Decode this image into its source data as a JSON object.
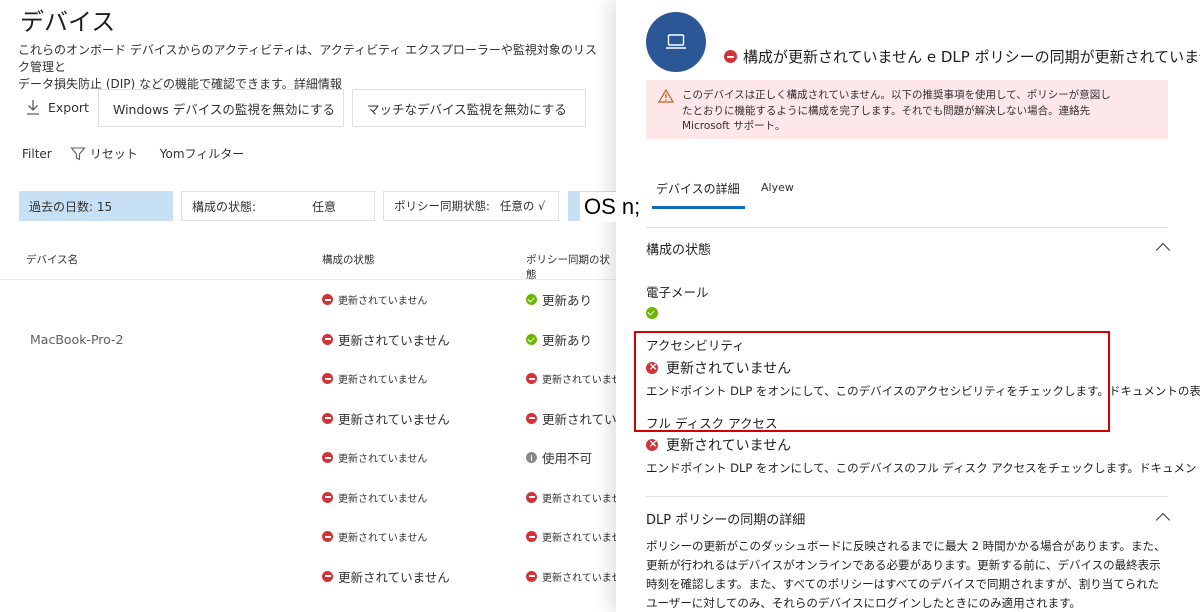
{
  "left": {
    "title": "デバイス",
    "description_line1": "これらのオンボード デバイスからのアクティビティは、アクティビティ エクスプローラーや監視対象のリスク管理と",
    "description_line2": "データ損失防止 (DIP) などの機能で確認できます。",
    "description_link": "詳細情報",
    "toolbar": {
      "export_label": "Export",
      "btn_windows": "Windows デバイスの監視を無効にする",
      "btn_mac": "マッチなデバイス監視を無効にする"
    },
    "filter": {
      "label": "Filter",
      "reset_label": "リセット",
      "yom_filter": "Yomフィルター"
    },
    "chips": {
      "days": "過去の日数: 15",
      "config_label": "構成の状態:",
      "config_value": "任意",
      "policy_label": "ポリシー同期状態:",
      "policy_value": "任意の √",
      "os_label": ""
    },
    "table": {
      "headers": [
        "デバイス名",
        "構成の状態",
        "ポリシー同期の状態"
      ],
      "rows": [
        {
          "name": "",
          "cfg": "更新されていません",
          "cfg_icon": "red",
          "cfg_size": "sm",
          "pol": "更新あり",
          "pol_icon": "green",
          "pol_size": "lg"
        },
        {
          "name": "MacBook-Pro-2",
          "cfg": "更新されていません",
          "cfg_icon": "red",
          "cfg_size": "lg",
          "pol": "更新あり",
          "pol_icon": "green",
          "pol_size": "lg"
        },
        {
          "name": "",
          "cfg": "更新されていません",
          "cfg_icon": "red",
          "cfg_size": "sm",
          "pol": "更新されていません",
          "pol_icon": "red",
          "pol_size": "sm"
        },
        {
          "name": "",
          "cfg": "更新されていません",
          "cfg_icon": "red",
          "cfg_size": "lg",
          "pol": "更新されていません",
          "pol_icon": "red",
          "pol_size": "lg"
        },
        {
          "name": "",
          "cfg": "更新されていません",
          "cfg_icon": "red",
          "cfg_size": "sm",
          "pol": "使用不可",
          "pol_icon": "gray",
          "pol_size": "lg"
        },
        {
          "name": "",
          "cfg": "更新されていません",
          "cfg_icon": "red",
          "cfg_size": "sm",
          "pol": "更新されていません",
          "pol_icon": "red",
          "pol_size": "sm"
        },
        {
          "name": "",
          "cfg": "更新されていません",
          "cfg_icon": "red",
          "cfg_size": "sm",
          "pol": "更新されていません",
          "pol_icon": "red",
          "pol_size": "sm"
        },
        {
          "name": "",
          "cfg": "更新されていません",
          "cfg_icon": "red",
          "cfg_size": "lg",
          "pol": "更新されていません",
          "pol_icon": "red",
          "pol_size": "sm"
        }
      ]
    }
  },
  "overlay_text": "OS n;",
  "panel": {
    "device_icon": "laptop-icon",
    "status_heading": "構成が更新されていません e DLP ポリシーの同期が更新されていません",
    "warning": "このデバイスは正しく構成されていません。以下の推奨事項を使用して、ポリシーが意図したとおりに機能するように構成を完了します。それでも問題が解決しない場合。連絡先 Microsoft サポート。",
    "tabs": [
      "デバイスの詳細",
      "Alyew"
    ],
    "config_section": "構成の状態",
    "email_label": "電子メール",
    "accessibility_label": "アクセシビリティ",
    "accessibility_status": "更新されていません",
    "accessibility_note": "エンドポイント DLP をオンにして、このデバイスのアクセシビリティをチェックします。ドキュメントの表示",
    "fda_label": "フル ディスク アクセス",
    "fda_status": "更新されていません",
    "fda_note": "エンドポイント DLP をオンにして、このデバイスのフル ディスク アクセスをチェックします。ドキュメントの表示",
    "dlp_section": "DLP ポリシーの同期の詳細",
    "dlp_paragraph": "ポリシーの更新がこのダッシュボードに反映されるまでに最大 2 時間かかる場合があります。また、更新が行われるはデバイスがオンラインである必要があります。更新する前に、デバイスの最終表示時刻を確認します。また、すべてのポリシーはすべてのデバイスで同期されますが、割り当てられたユーザーに対してのみ、それらのデバイスにログインしたときにのみ適用されます。"
  },
  "colors": {
    "accent": "#0f6cbd",
    "avatar": "#2b5797",
    "error": "#d13438",
    "success": "#6bb700",
    "warning_bg": "#fde7e9",
    "chip_selected": "#c7e0f4",
    "highlight_border": "#d70000"
  }
}
